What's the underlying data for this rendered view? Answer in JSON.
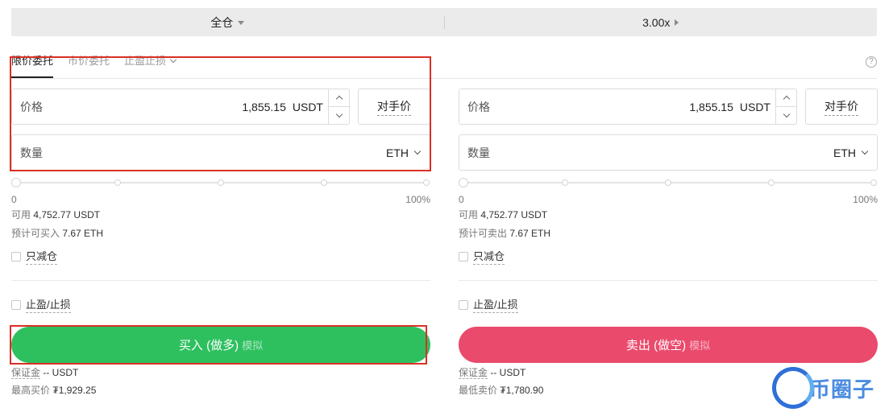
{
  "topbar": {
    "margin_mode": "全仓",
    "leverage": "3.00x"
  },
  "tabs": [
    {
      "label": "限价委托"
    },
    {
      "label": "市价委托"
    },
    {
      "label": "止盈止损"
    }
  ],
  "help_icon": "?",
  "buy_panel": {
    "price_label": "价格",
    "price_value": "1,855.15",
    "price_unit": "USDT",
    "counter_label": "对手价",
    "qty_label": "数量",
    "qty_unit": "ETH",
    "slider_min": "0",
    "slider_max": "100%",
    "slider_level": 0,
    "available_label": "可用",
    "available_value": "4,752.77 USDT",
    "est_label": "预计可买入",
    "est_value": "7.67 ETH",
    "reduce_only": "只减仓",
    "tp_sl": "止盈/止损",
    "action_label": "买入 (做多)",
    "action_sim": "模拟",
    "margin_label": "保证金",
    "margin_value": "-- USDT",
    "limit_label": "最高买价",
    "limit_value": "₮1,929.25"
  },
  "sell_panel": {
    "price_label": "价格",
    "price_value": "1,855.15",
    "price_unit": "USDT",
    "counter_label": "对手价",
    "qty_label": "数量",
    "qty_unit": "ETH",
    "slider_min": "0",
    "slider_max": "100%",
    "slider_level": 0,
    "available_label": "可用",
    "available_value": "4,752.77 USDT",
    "est_label": "预计可卖出",
    "est_value": "7.67 ETH",
    "reduce_only": "只减仓",
    "tp_sl": "止盈/止损",
    "action_label": "卖出 (做空)",
    "action_sim": "模拟",
    "margin_label": "保证金",
    "margin_value": "-- USDT",
    "limit_label": "最低卖价",
    "limit_value": "₮1,780.90"
  },
  "watermark": {
    "text": "币圈子"
  },
  "colors": {
    "buy": "#2ec05f",
    "sell": "#ea4a6c",
    "highlight": "#d93025"
  }
}
